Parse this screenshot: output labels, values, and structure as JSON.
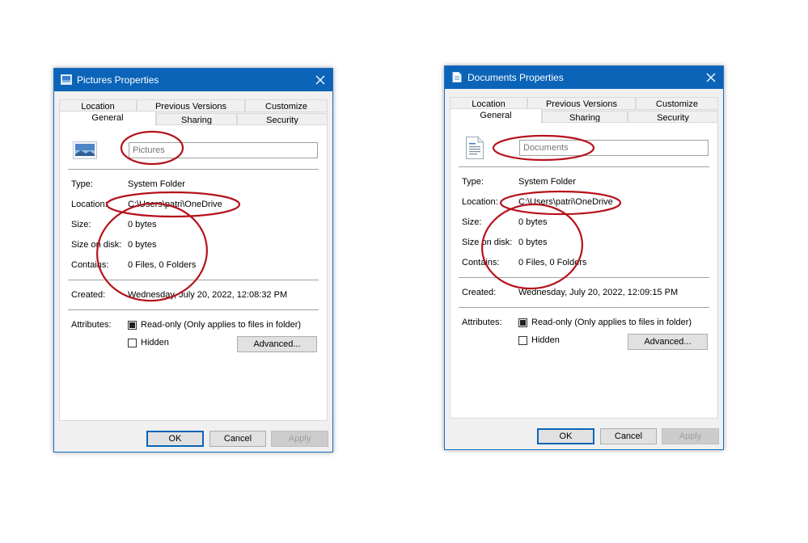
{
  "left_dialog": {
    "title": "Pictures Properties",
    "tabs_top": [
      "Location",
      "Previous Versions",
      "Customize"
    ],
    "tabs_bottom": [
      "General",
      "Sharing",
      "Security"
    ],
    "name_placeholder": "Pictures",
    "type_label": "Type:",
    "type_value": "System Folder",
    "location_label": "Location:",
    "location_value": "C:\\Users\\patri\\OneDrive",
    "size_label": "Size:",
    "size_value": "0 bytes",
    "size_on_disk_label": "Size on disk:",
    "size_on_disk_value": "0 bytes",
    "contains_label": "Contains:",
    "contains_value": "0 Files, 0 Folders",
    "created_label": "Created:",
    "created_value": "Wednesday, July 20, 2022, 12:08:32 PM",
    "attributes_label": "Attributes:",
    "readonly_label": "Read-only (Only applies to files in folder)",
    "readonly_checked": true,
    "hidden_label": "Hidden",
    "hidden_checked": false,
    "advanced_label": "Advanced...",
    "ok_label": "OK",
    "cancel_label": "Cancel",
    "apply_label": "Apply",
    "icon": "pictures-folder-icon"
  },
  "right_dialog": {
    "title": "Documents Properties",
    "tabs_top": [
      "Location",
      "Previous Versions",
      "Customize"
    ],
    "tabs_bottom": [
      "General",
      "Sharing",
      "Security"
    ],
    "name_placeholder": "Documents",
    "type_label": "Type:",
    "type_value": "System Folder",
    "location_label": "Location:",
    "location_value": "C:\\Users\\patri\\OneDrive",
    "size_label": "Size:",
    "size_value": "0 bytes",
    "size_on_disk_label": "Size on disk:",
    "size_on_disk_value": "0 bytes",
    "contains_label": "Contains:",
    "contains_value": "0 Files, 0 Folders",
    "created_label": "Created:",
    "created_value": "Wednesday, July 20, 2022, 12:09:15 PM",
    "attributes_label": "Attributes:",
    "readonly_label": "Read-only (Only applies to files in folder)",
    "readonly_checked": true,
    "hidden_label": "Hidden",
    "hidden_checked": false,
    "advanced_label": "Advanced...",
    "ok_label": "OK",
    "cancel_label": "Cancel",
    "apply_label": "Apply",
    "icon": "documents-folder-icon"
  },
  "colors": {
    "titlebar": "#0b64b8",
    "annotation": "#b5121b"
  }
}
